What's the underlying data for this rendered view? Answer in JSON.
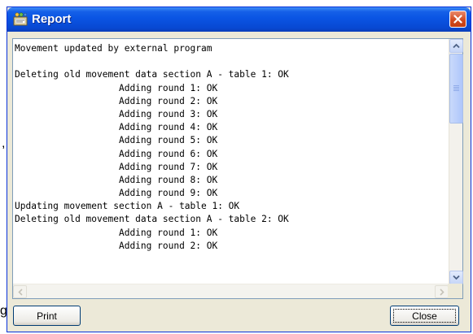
{
  "background": {
    "fragment_comma": ",",
    "fragment_g": "g"
  },
  "window": {
    "title": "Report",
    "close_icon": "close-x-icon",
    "app_icon": "report-window-icon"
  },
  "report": {
    "lines": [
      "Movement updated by external program",
      "",
      "Deleting old movement data section A - table 1: OK",
      "                   Adding round 1: OK",
      "                   Adding round 2: OK",
      "                   Adding round 3: OK",
      "                   Adding round 4: OK",
      "                   Adding round 5: OK",
      "                   Adding round 6: OK",
      "                   Adding round 7: OK",
      "                   Adding round 8: OK",
      "                   Adding round 9: OK",
      "Updating movement section A - table 1: OK",
      "Deleting old movement data section A - table 2: OK",
      "                   Adding round 1: OK",
      "                   Adding round 2: OK"
    ]
  },
  "buttons": {
    "print": "Print",
    "close": "Close"
  }
}
